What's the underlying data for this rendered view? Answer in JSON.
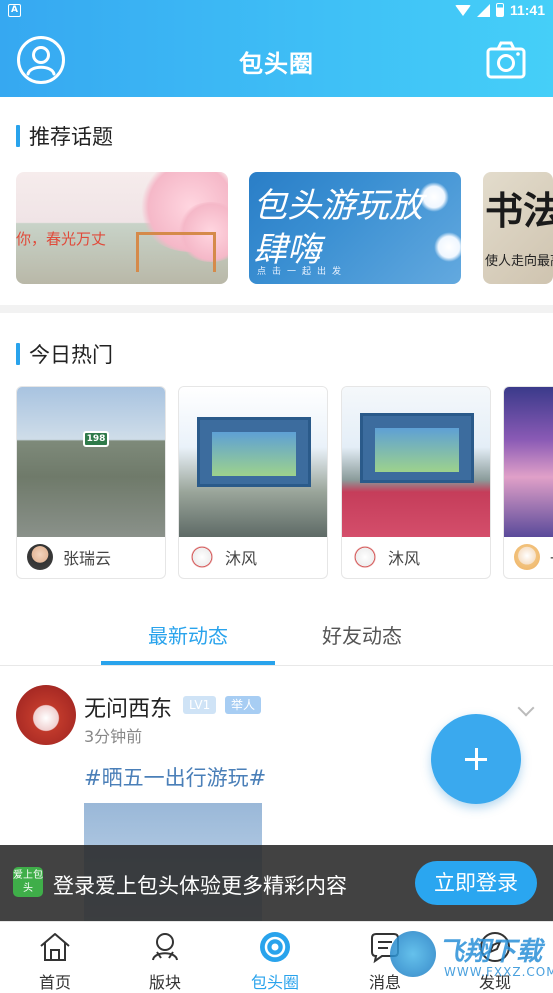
{
  "status_bar": {
    "carrier_icon": "A",
    "time": "11:41"
  },
  "header": {
    "title": "包头圈",
    "profile_icon": "user-icon",
    "camera_icon": "camera-icon"
  },
  "recommended": {
    "title": "推荐话题",
    "topics": [
      {
        "text": "你，春光万丈"
      },
      {
        "text": "包头游玩放肆嗨",
        "sub": "点击一起出发"
      },
      {
        "text": "书法",
        "sub": "使人走向最高"
      }
    ]
  },
  "hot_today": {
    "title": "今日热门",
    "cards": [
      {
        "user": "张瑞云",
        "badge": "198"
      },
      {
        "user": "沐风"
      },
      {
        "user": "沐风"
      },
      {
        "user": "一"
      }
    ]
  },
  "tabs": {
    "latest": "最新动态",
    "friends": "好友动态"
  },
  "post": {
    "author": "无问西东",
    "level": "LV1",
    "role": "举人",
    "time": "3分钟前",
    "tag": "#晒五一出行游玩#"
  },
  "fab": {
    "icon": "plus-icon"
  },
  "login_banner": {
    "logo_text": "爱上包头",
    "message": "登录爱上包头体验更多精彩内容",
    "button": "立即登录"
  },
  "bottom_nav": [
    {
      "label": "首页",
      "icon": "home-icon"
    },
    {
      "label": "版块",
      "icon": "section-icon"
    },
    {
      "label": "包头圈",
      "icon": "circle-icon",
      "active": true
    },
    {
      "label": "消息",
      "icon": "message-icon"
    },
    {
      "label": "发现",
      "icon": "discover-icon"
    }
  ],
  "watermark": {
    "text": "飞翔下载",
    "sub": "WWW.FXXZ.COM"
  },
  "colors": {
    "accent": "#29a3ec",
    "header_start": "#36a8f1",
    "header_end": "#45cff8",
    "badge_lv": "#cfe3f6",
    "badge_role": "#a7cdf3"
  }
}
